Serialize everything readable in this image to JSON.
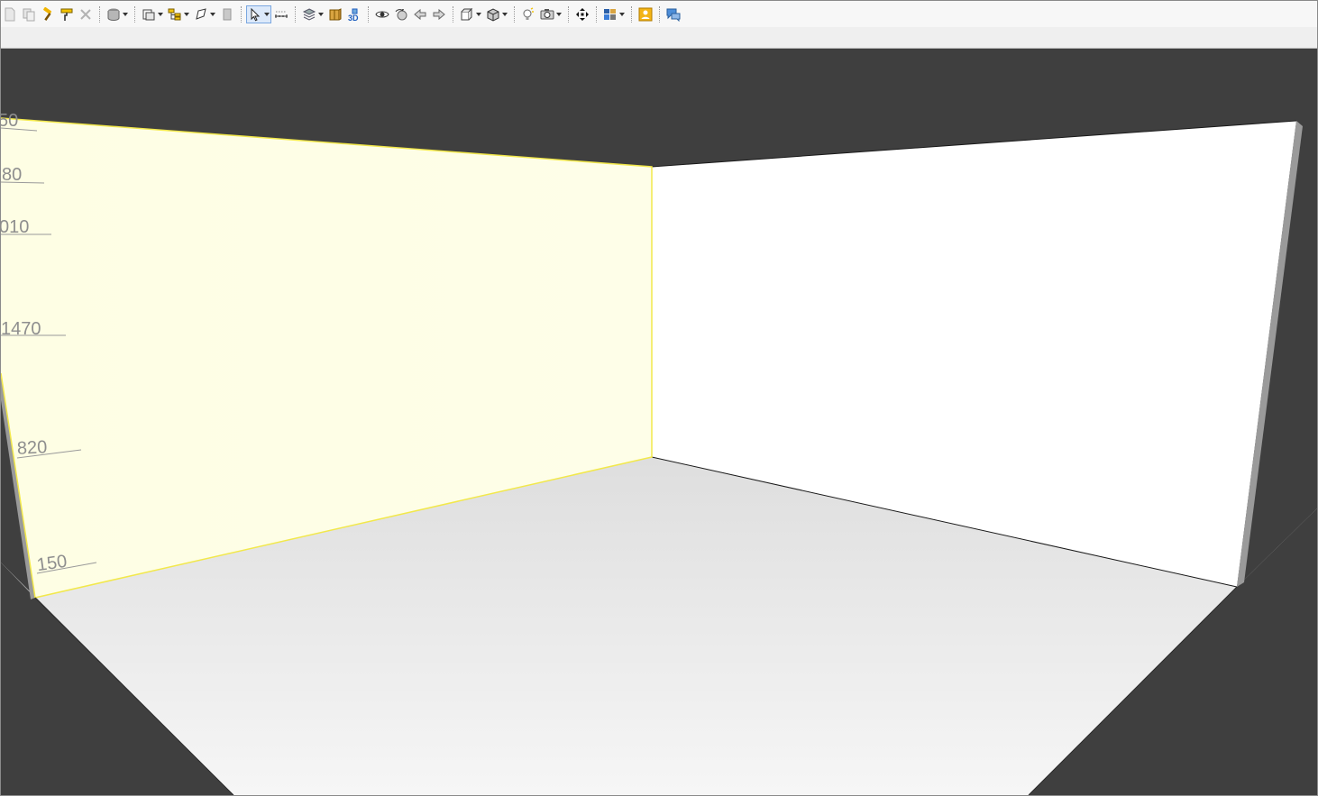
{
  "toolbar": {
    "buttons": [
      {
        "name": "new-doc-icon",
        "drop": false
      },
      {
        "name": "copy-icon",
        "drop": false
      },
      {
        "name": "hammer-icon",
        "drop": false
      },
      {
        "name": "paint-roller-icon",
        "drop": false
      },
      {
        "name": "delete-icon",
        "drop": false
      },
      "sep",
      {
        "name": "database-icon",
        "drop": true
      },
      "sep",
      {
        "name": "wall-layout-icon",
        "drop": true
      },
      {
        "name": "hierarchy-icon",
        "drop": true
      },
      {
        "name": "freeform-shape-icon",
        "drop": true
      },
      {
        "name": "panel-icon",
        "drop": false
      },
      "sep",
      {
        "name": "select-arrow-icon",
        "drop": true,
        "active": true
      },
      {
        "name": "measure-icon",
        "drop": false
      },
      "sep",
      {
        "name": "layers-icon",
        "drop": true
      },
      {
        "name": "cabinet-icon",
        "drop": false
      },
      {
        "name": "3d-view-icon",
        "drop": false
      },
      "sep",
      {
        "name": "eye-icon",
        "drop": false
      },
      {
        "name": "orbit-icon",
        "drop": false
      },
      {
        "name": "arrow-left-icon",
        "drop": false
      },
      {
        "name": "arrow-right-icon",
        "drop": false
      },
      "sep",
      {
        "name": "view-cube-icon",
        "drop": true
      },
      {
        "name": "box-icon",
        "drop": true
      },
      "sep",
      {
        "name": "light-bulb-icon",
        "drop": false
      },
      {
        "name": "camera-icon",
        "drop": true
      },
      "sep",
      {
        "name": "move-arrows-icon",
        "drop": false
      },
      "sep",
      {
        "name": "color-palette-icon",
        "drop": true
      },
      "sep",
      {
        "name": "user-card-icon",
        "drop": false
      },
      "sep",
      {
        "name": "chat-icon",
        "drop": false
      }
    ]
  },
  "scene": {
    "dimension_labels": [
      "50",
      "80",
      "010",
      "1470",
      "820",
      "150"
    ],
    "colors": {
      "background": "#3f3f3f",
      "selected_wall": "#fefee6",
      "selected_edge": "#f2e84b",
      "right_wall": "#ffffff",
      "floor_light": "#f4f4f4",
      "floor_dark": "#dedede",
      "wall_edge": "#1a1a1a"
    }
  }
}
